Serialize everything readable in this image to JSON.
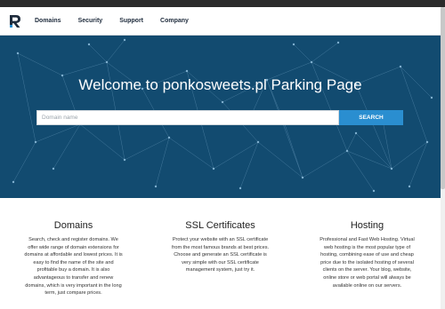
{
  "colors": {
    "hero_background": "#124b70",
    "accent": "#2a8ed0",
    "nav_text": "#1e2b3c",
    "logo_dark": "#1e2b3c",
    "logo_accent": "#2a8ed0"
  },
  "header": {
    "logo_icon": "r-logo-icon",
    "nav": [
      {
        "label": "Domains"
      },
      {
        "label": "Security"
      },
      {
        "label": "Support"
      },
      {
        "label": "Company"
      }
    ]
  },
  "hero": {
    "title": "Welcome to ponkosweets.pl Parking Page",
    "search": {
      "placeholder": "Domain name",
      "value": "",
      "button_label": "SEARCH"
    }
  },
  "features": [
    {
      "title": "Domains",
      "text": "Search, check and register domains. We offer wide range of domain extensions for domains at affordable and lowest prices. It is easy to find the name of the site and profitable buy a domain. It is also advantageous to transfer and renew domains, which is very important in the long term, just compare prices."
    },
    {
      "title": "SSL Certificates",
      "text": "Protect your website with an SSL certificate from the most famous brands at best prices. Choose and generate an SSL certificate is very simple with our SSL certificate management system, just try it."
    },
    {
      "title": "Hosting",
      "text": "Professional and Fast Web Hosting. Virtual web hosting is the most popular type of hosting, combining ease of use and cheap price due to the isolated hosting of several clients on the server. Your blog, website, online store or web portal will always be available online on our servers."
    }
  ]
}
